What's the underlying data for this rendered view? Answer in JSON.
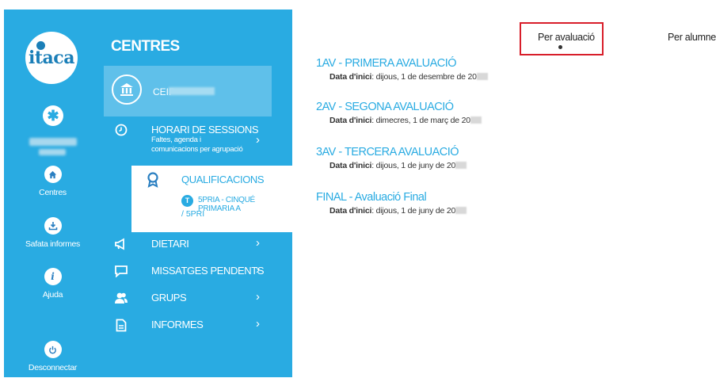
{
  "app": {
    "logo_text": "itaca"
  },
  "rail": {
    "avatar_icon": "asterisk-icon",
    "buttons": [
      {
        "label": "Centres",
        "icon": "home-icon"
      },
      {
        "label": "Safata informes",
        "icon": "download-tray-icon"
      },
      {
        "label": "Ajuda",
        "icon": "info-icon"
      },
      {
        "label": "Desconnectar",
        "icon": "power-icon"
      }
    ]
  },
  "menu": {
    "title": "CENTRES",
    "centre_name": "CEIP",
    "horari": {
      "label": "HORARI DE SESSIONS",
      "sub1": "Faltes, agenda i",
      "sub2": "comunicacions per agrupació"
    },
    "qualificacions": {
      "label": "QUALIFICACIONS",
      "badge": "T",
      "group": "5PRIA - CINQUÉ PRIMARIA A",
      "group_code": "/ 5PRI"
    },
    "items": [
      {
        "label": "DIETARI",
        "icon": "megaphone-icon"
      },
      {
        "label": "MISSATGES PENDENTS",
        "icon": "chat-icon"
      },
      {
        "label": "GRUPS",
        "icon": "users-icon"
      },
      {
        "label": "INFORMES",
        "icon": "document-icon"
      }
    ]
  },
  "tabs": {
    "active": "Per avaluació",
    "other": "Per alumne"
  },
  "evaluations": [
    {
      "name": "1AV - PRIMERA AVALUACIÓ",
      "date_label": "Data d'inici",
      "date": ": dijous, 1 de desembre de 20"
    },
    {
      "name": "2AV - SEGONA AVALUACIÓ",
      "date_label": "Data d'inici",
      "date": ": dimecres, 1 de març de 20"
    },
    {
      "name": "3AV - TERCERA AVALUACIÓ",
      "date_label": "Data d'inici",
      "date": ": dijous, 1 de juny de 20"
    },
    {
      "name": "FINAL - Avaluació Final",
      "date_label": "Data d'inici",
      "date": ": dijous, 1 de juny de 20"
    }
  ],
  "colors": {
    "brand": "#29ABE2",
    "highlight": "#D81E2A",
    "selected_bg": "#5FC0EA"
  }
}
